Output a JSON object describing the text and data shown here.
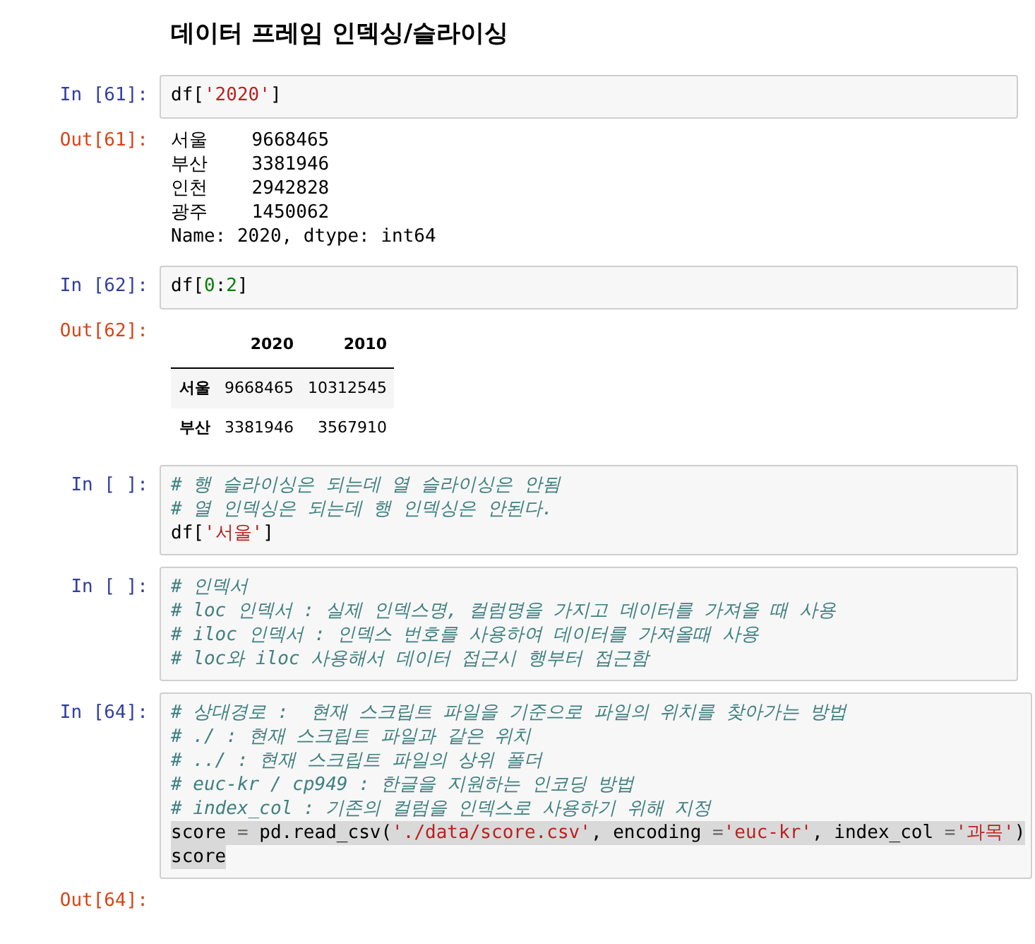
{
  "heading": "데이터 프레임 인덱싱/슬라이싱",
  "cells": [
    {
      "prompt": "In [61]:",
      "lines": [
        {
          "highlighted": false,
          "tokens": [
            {
              "kind": "plain",
              "t": "df["
            },
            {
              "kind": "string",
              "t": "'2020'"
            },
            {
              "kind": "plain",
              "t": "]"
            }
          ]
        }
      ],
      "output": {
        "kind": "text",
        "prompt": "Out[61]:",
        "lines": [
          "서울    9668465",
          "부산    3381946",
          "인천    2942828",
          "광주    1450062",
          "Name: 2020, dtype: int64"
        ]
      }
    },
    {
      "prompt": "In [62]:",
      "lines": [
        {
          "highlighted": false,
          "tokens": [
            {
              "kind": "plain",
              "t": "df["
            },
            {
              "kind": "number",
              "t": "0"
            },
            {
              "kind": "plain",
              "t": ":"
            },
            {
              "kind": "number",
              "t": "2"
            },
            {
              "kind": "plain",
              "t": "]"
            }
          ]
        }
      ],
      "output": {
        "kind": "table",
        "prompt": "Out[62]:",
        "columns": [
          "2020",
          "2010"
        ],
        "rows": [
          {
            "index": "서울",
            "cells": [
              "9668465",
              "10312545"
            ]
          },
          {
            "index": "부산",
            "cells": [
              "3381946",
              "3567910"
            ]
          }
        ]
      }
    },
    {
      "prompt": "In [ ]:",
      "lines": [
        {
          "highlighted": false,
          "tokens": [
            {
              "kind": "comment",
              "t": "# 행 슬라이싱은 되는데 열 슬라이싱은 안됨"
            }
          ]
        },
        {
          "highlighted": false,
          "tokens": [
            {
              "kind": "comment",
              "t": "# 열 인덱싱은 되는데 행 인덱싱은 안된다."
            }
          ]
        },
        {
          "highlighted": false,
          "tokens": [
            {
              "kind": "plain",
              "t": "df["
            },
            {
              "kind": "string",
              "t": "'서울'"
            },
            {
              "kind": "plain",
              "t": "]"
            }
          ]
        }
      ]
    },
    {
      "prompt": "In [ ]:",
      "lines": [
        {
          "highlighted": false,
          "tokens": [
            {
              "kind": "comment",
              "t": "# 인덱서"
            }
          ]
        },
        {
          "highlighted": false,
          "tokens": [
            {
              "kind": "comment",
              "t": "# loc 인덱서 : 실제 인덱스명, 컬럼명을 가지고 데이터를 가져올 때 사용"
            }
          ]
        },
        {
          "highlighted": false,
          "tokens": [
            {
              "kind": "comment",
              "t": "# iloc 인덱서 : 인덱스 번호를 사용하여 데이터를 가져올때 사용"
            }
          ]
        },
        {
          "highlighted": false,
          "tokens": [
            {
              "kind": "comment",
              "t": "# loc와 iloc 사용해서 데이터 접근시 행부터 접근함"
            }
          ]
        }
      ]
    },
    {
      "prompt": "In [64]:",
      "lines": [
        {
          "highlighted": false,
          "tokens": [
            {
              "kind": "comment",
              "t": "# 상대경로 :  현재 스크립트 파일을 기준으로 파일의 위치를 찾아가는 방법"
            }
          ]
        },
        {
          "highlighted": false,
          "tokens": [
            {
              "kind": "comment",
              "t": "# ./ : 현재 스크립트 파일과 같은 위치"
            }
          ]
        },
        {
          "highlighted": false,
          "tokens": [
            {
              "kind": "comment",
              "t": "# ../ : 현재 스크립트 파일의 상위 폴더"
            }
          ]
        },
        {
          "highlighted": false,
          "tokens": [
            {
              "kind": "comment",
              "t": "# euc-kr / cp949 : 한글을 지원하는 인코딩 방법"
            }
          ]
        },
        {
          "highlighted": false,
          "tokens": [
            {
              "kind": "comment",
              "t": "# index_col : 기존의 컬럼을 인덱스로 사용하기 위해 지정"
            }
          ]
        },
        {
          "highlighted": true,
          "tokens": [
            {
              "kind": "plain",
              "t": "score "
            },
            {
              "kind": "operator",
              "t": "="
            },
            {
              "kind": "plain",
              "t": " pd.read_csv("
            },
            {
              "kind": "string",
              "t": "'./data/score.csv'"
            },
            {
              "kind": "plain",
              "t": ", encoding "
            },
            {
              "kind": "operator",
              "t": "="
            },
            {
              "kind": "string",
              "t": "'euc-kr'"
            },
            {
              "kind": "plain",
              "t": ", index_col "
            },
            {
              "kind": "operator",
              "t": "="
            },
            {
              "kind": "string",
              "t": "'과목'"
            },
            {
              "kind": "plain",
              "t": ")"
            }
          ]
        },
        {
          "highlighted": true,
          "tokens": [
            {
              "kind": "plain",
              "t": "score"
            }
          ]
        }
      ],
      "output": {
        "kind": "empty",
        "prompt": "Out[64]:"
      }
    }
  ]
}
